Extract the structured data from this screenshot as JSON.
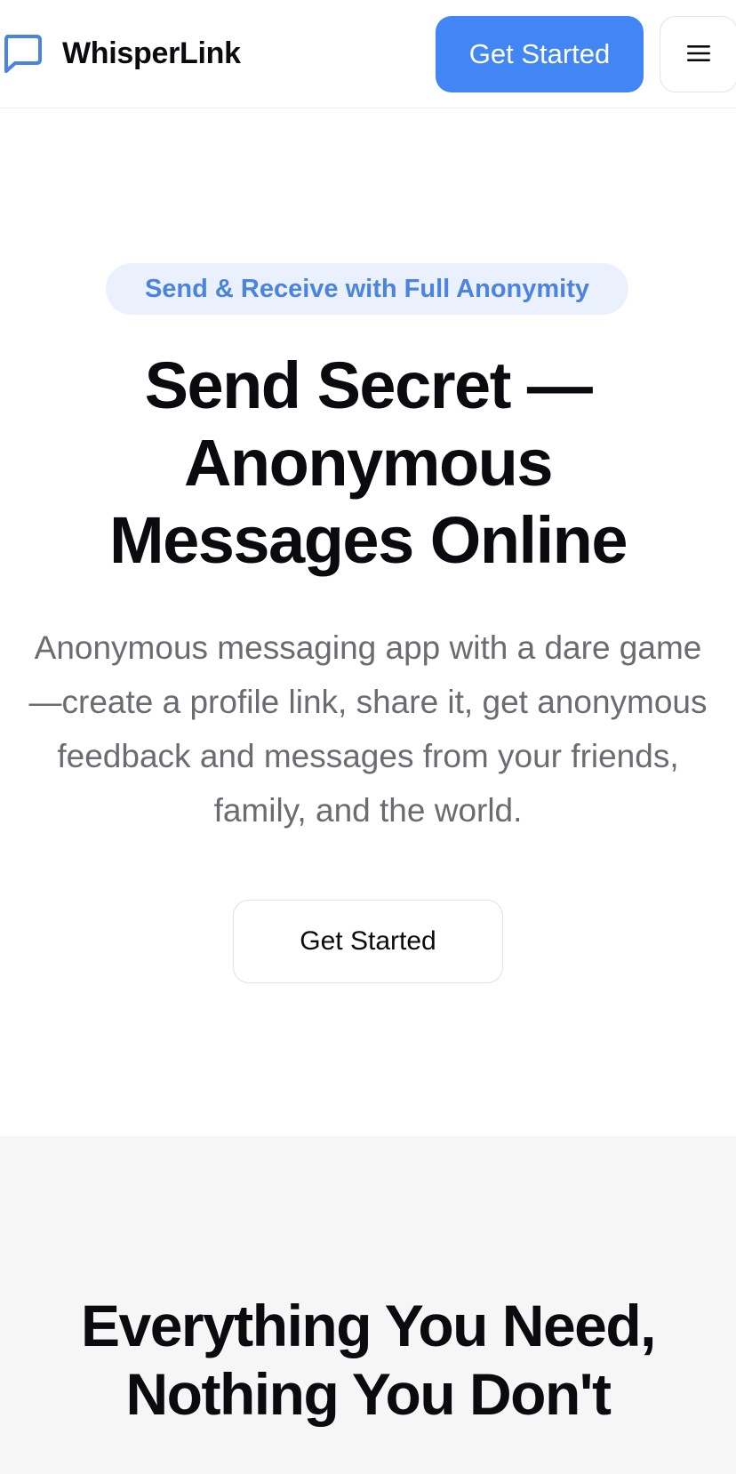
{
  "header": {
    "brand_name": "WhisperLink",
    "brand_icon": "message-square-icon",
    "get_started_label": "Get Started",
    "menu_icon": "hamburger-menu-icon"
  },
  "hero": {
    "badge": "Send & Receive with Full Anonymity",
    "title_line1": "Send Secret —",
    "title_line2": "Anonymous",
    "title_line3": "Messages Online",
    "subtitle": "Anonymous messaging app with a dare game—create a profile link, share it, get anonymous feedback and messages from your friends, family, and the world.",
    "cta_label": "Get Started"
  },
  "features": {
    "title_line1": "Everything You Need,",
    "title_line2": "Nothing You Don't"
  },
  "colors": {
    "accent": "#4285f4",
    "badge_bg": "#eaf1fd",
    "badge_text": "#4a83e0",
    "muted_text": "#6b6b72",
    "section_bg": "#f6f6f7"
  }
}
